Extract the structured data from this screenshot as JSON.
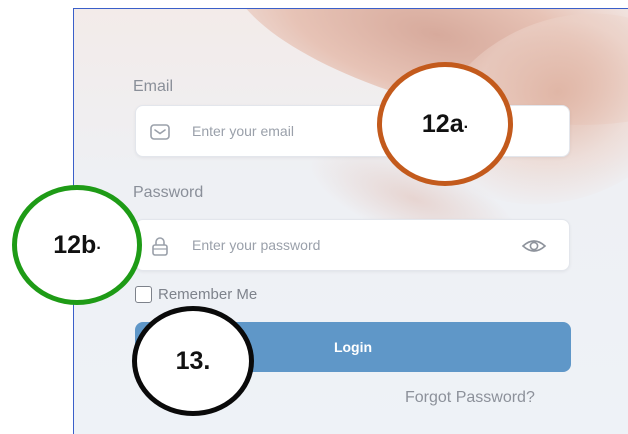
{
  "form": {
    "email_label": "Email",
    "email_placeholder": "Enter your email",
    "password_label": "Password",
    "password_placeholder": "Enter your password",
    "remember_label": "Remember Me",
    "remember_checked": false,
    "login_label": "Login",
    "forgot_label": "Forgot Password?"
  },
  "callouts": {
    "email": {
      "number": "12a",
      "dot": ".",
      "color": "#c35a1c"
    },
    "password": {
      "number": "12b",
      "dot": ".",
      "color": "#1e9b16"
    },
    "login": {
      "number": "13.",
      "color": "#0a0a0a"
    }
  },
  "icons": {
    "email": "envelope-icon",
    "password": "lock-icon",
    "visibility": "eye-icon"
  },
  "colors": {
    "button": "#5f97c8",
    "frame": "#3a5fc9"
  }
}
